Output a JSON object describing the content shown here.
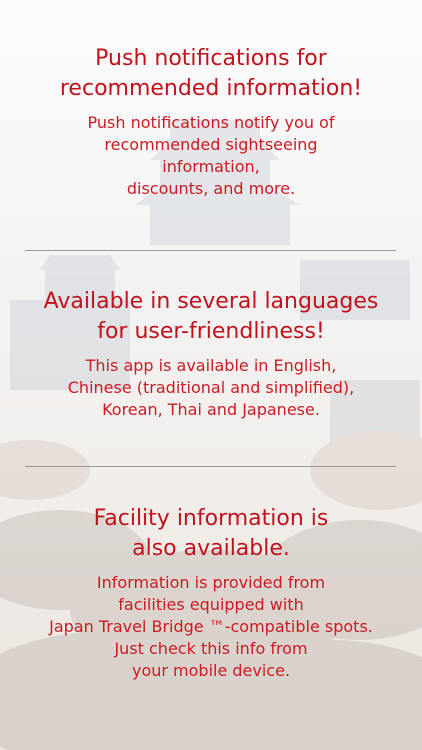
{
  "sections": [
    {
      "title_lines": [
        "Push notifications for",
        "recommended information!"
      ],
      "body_lines": [
        "Push notifications notify you of",
        "recommended sightseeing",
        "information,",
        "discounts, and more."
      ]
    },
    {
      "title_lines": [
        "Available in several languages",
        "for user-friendliness!"
      ],
      "body_lines": [
        "This app is available in English,",
        "Chinese (traditional and simplified),",
        "Korean, Thai and Japanese."
      ]
    },
    {
      "title_lines": [
        "Facility information is",
        "also available."
      ],
      "body_lines": [
        "Information is provided from",
        "facilities equipped with",
        "Japan Travel Bridge ™-compatible spots.",
        "Just check this info from",
        "your mobile device."
      ]
    }
  ],
  "colors": {
    "title": "#c1121c",
    "body": "#cc1a22",
    "separator": "#9a9a9a"
  }
}
